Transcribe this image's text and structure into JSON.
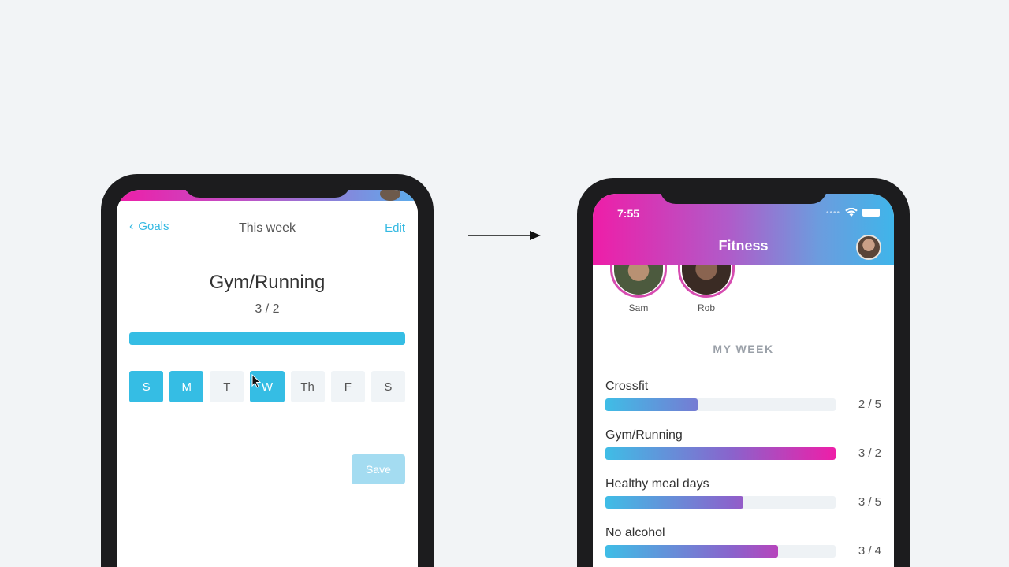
{
  "left_screen": {
    "back_label": "Goals",
    "header_title": "This week",
    "edit_label": "Edit",
    "goal_title": "Gym/Running",
    "goal_count": "3 / 2",
    "goal_progress": 1.0,
    "days": [
      {
        "label": "S",
        "selected": true
      },
      {
        "label": "M",
        "selected": true
      },
      {
        "label": "T",
        "selected": false
      },
      {
        "label": "W",
        "selected": true
      },
      {
        "label": "Th",
        "selected": false
      },
      {
        "label": "F",
        "selected": false
      },
      {
        "label": "S",
        "selected": false
      }
    ],
    "save_label": "Save"
  },
  "right_screen": {
    "status_time": "7:55",
    "title": "Fitness",
    "friends": [
      {
        "name": "Sam"
      },
      {
        "name": "Rob"
      }
    ],
    "section_title": "MY WEEK",
    "goals": [
      {
        "label": "Crossfit",
        "count": "2 / 5",
        "progress": 0.4
      },
      {
        "label": "Gym/Running",
        "count": "3 / 2",
        "progress": 1.0
      },
      {
        "label": "Healthy meal days",
        "count": "3 / 5",
        "progress": 0.6
      },
      {
        "label": "No alcohol",
        "count": "3 / 4",
        "progress": 0.75
      }
    ]
  },
  "colors": {
    "accent": "#35bde4",
    "pink": "#ee1ea8",
    "save_disabled": "#a4dcf1"
  }
}
